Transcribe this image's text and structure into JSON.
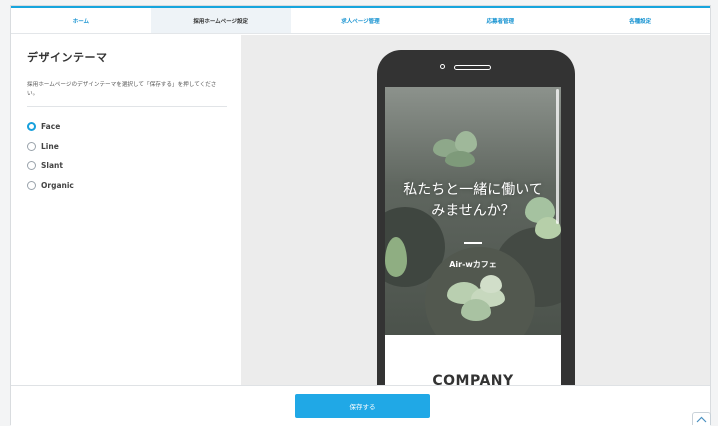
{
  "nav": {
    "tabs": [
      {
        "label": "ホーム"
      },
      {
        "label": "採用ホームページ設定"
      },
      {
        "label": "求人ページ管理"
      },
      {
        "label": "応募者管理"
      },
      {
        "label": "各種設定"
      }
    ],
    "active_index": 1
  },
  "sidebar": {
    "title": "デザインテーマ",
    "description": "採用ホームページのデザインテーマを選択して「保存する」を押してください。",
    "options": [
      {
        "label": "Face",
        "selected": true
      },
      {
        "label": "Line",
        "selected": false
      },
      {
        "label": "Slant",
        "selected": false
      },
      {
        "label": "Organic",
        "selected": false
      }
    ]
  },
  "preview": {
    "hero_line1": "私たちと一緒に働いて",
    "hero_line2": "みませんか？",
    "company_name": "Air-wカフェ",
    "section_heading": "COMPANY"
  },
  "footer": {
    "save_label": "保存する"
  },
  "colors": {
    "accent": "#17a5dd",
    "button": "#20a8e6",
    "phone_body": "#333333"
  },
  "icons": {
    "radio_selected": "radio-selected-icon",
    "back_to_top": "chevron-up-icon"
  }
}
